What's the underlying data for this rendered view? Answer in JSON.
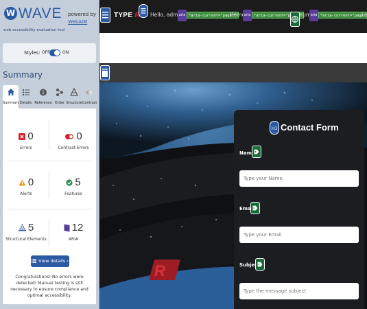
{
  "wave": {
    "logo_letter": "W",
    "logo_text": "WAVE",
    "tagline": "web accessibility evaluation tool",
    "powered_by": "powered by",
    "webaim_link": "WebAIM",
    "styles_label": "Styles:",
    "styles_off": "OFF",
    "styles_on": "ON",
    "styles_enabled": true,
    "summary_title": "Summary",
    "tabs": [
      {
        "label": "Summary",
        "icon": "home-icon",
        "active": true
      },
      {
        "label": "Details",
        "icon": "list-icon",
        "active": false
      },
      {
        "label": "Reference",
        "icon": "info-icon",
        "active": false
      },
      {
        "label": "Order",
        "icon": "order-icon",
        "active": false
      },
      {
        "label": "Structure",
        "icon": "structure-icon",
        "active": false
      },
      {
        "label": "Contrast",
        "icon": "contrast-icon",
        "active": false
      }
    ],
    "stats": {
      "errors": {
        "count": "0",
        "label": "Errors"
      },
      "contrast_errors": {
        "count": "0",
        "label": "Contrast Errors"
      },
      "alerts": {
        "count": "0",
        "label": "Alerts"
      },
      "features": {
        "count": "5",
        "label": "Features"
      },
      "structural": {
        "count": "5",
        "label": "Structural Elements"
      },
      "aria": {
        "count": "12",
        "label": "ARIA"
      }
    },
    "view_details": "View details ›",
    "congrats": "Congratulations! No errors were detected! Manual testing is still necessary to ensure compliance and optimal accessibility."
  },
  "site": {
    "brand": "TYPE",
    "brand_mark": "R",
    "greeting": "Hello, admin",
    "aria_tag": "aria",
    "aria_current": "*aria-current=\"page\"*",
    "home": "Home",
    "forum_fragment": "rum",
    "logout_fragment": "Lo",
    "form": {
      "title": "Contact Form",
      "name_label": "Name",
      "name_placeholder": "Type your Name",
      "email_label": "Email",
      "email_placeholder": "Type your Email",
      "subject_label": "Subject",
      "subject_placeholder": "Type the message subject"
    }
  },
  "colors": {
    "wave_blue": "#2b5aa3",
    "error_red": "#d2232a",
    "alert_orange": "#e8a020",
    "feature_green": "#2e8b57",
    "aria_purple": "#5a3d99"
  }
}
